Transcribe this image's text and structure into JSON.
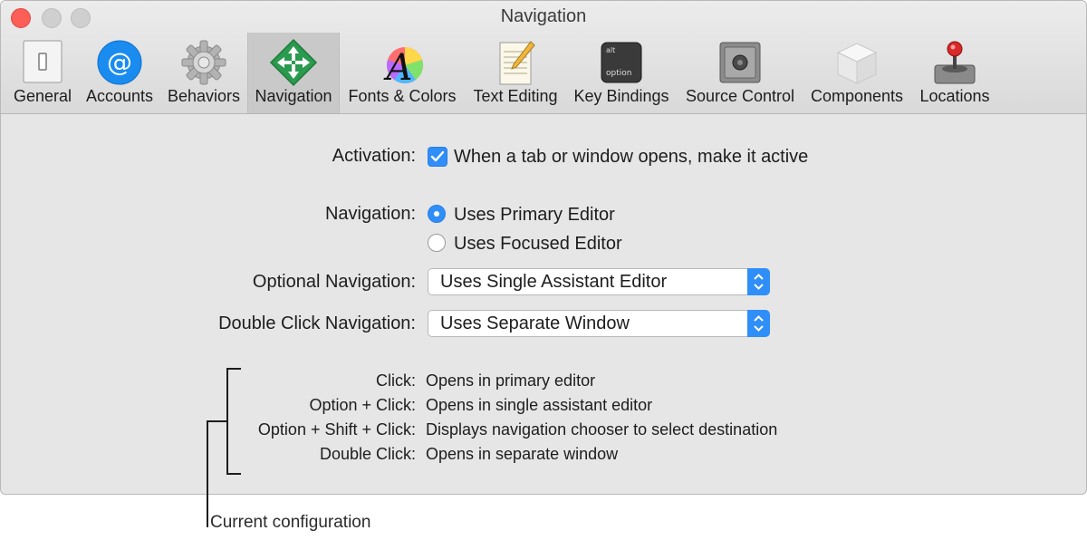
{
  "window": {
    "title": "Navigation"
  },
  "toolbar": {
    "tabs": [
      {
        "label": "General",
        "icon": "general-switch-icon"
      },
      {
        "label": "Accounts",
        "icon": "at-sign-icon"
      },
      {
        "label": "Behaviors",
        "icon": "gear-icon"
      },
      {
        "label": "Navigation",
        "icon": "navigation-arrows-icon",
        "selected": true
      },
      {
        "label": "Fonts & Colors",
        "icon": "font-color-wheel-icon"
      },
      {
        "label": "Text Editing",
        "icon": "notepad-pencil-icon"
      },
      {
        "label": "Key Bindings",
        "icon": "option-key-icon"
      },
      {
        "label": "Source Control",
        "icon": "safe-icon"
      },
      {
        "label": "Components",
        "icon": "cube-icon"
      },
      {
        "label": "Locations",
        "icon": "joystick-drive-icon"
      }
    ]
  },
  "activation": {
    "label": "Activation:",
    "option": "When a tab or window opens, make it active",
    "checked": true
  },
  "navigation": {
    "label": "Navigation:",
    "options": [
      "Uses Primary Editor",
      "Uses Focused Editor"
    ],
    "selected": "Uses Primary Editor"
  },
  "optional_navigation": {
    "label": "Optional Navigation:",
    "value": "Uses Single Assistant Editor"
  },
  "double_click_navigation": {
    "label": "Double Click Navigation:",
    "value": "Uses Separate Window"
  },
  "legend": [
    {
      "key": "Click:",
      "desc": "Opens in primary editor"
    },
    {
      "key": "Option + Click:",
      "desc": "Opens in single assistant editor"
    },
    {
      "key": "Option + Shift + Click:",
      "desc": "Displays navigation chooser to select destination"
    },
    {
      "key": "Double Click:",
      "desc": "Opens in separate window"
    }
  ],
  "annotation": "Current configuration",
  "colors": {
    "accent": "#2f8ef8",
    "close": "#fc5f57",
    "selected_tab": "#c9c9c9"
  }
}
